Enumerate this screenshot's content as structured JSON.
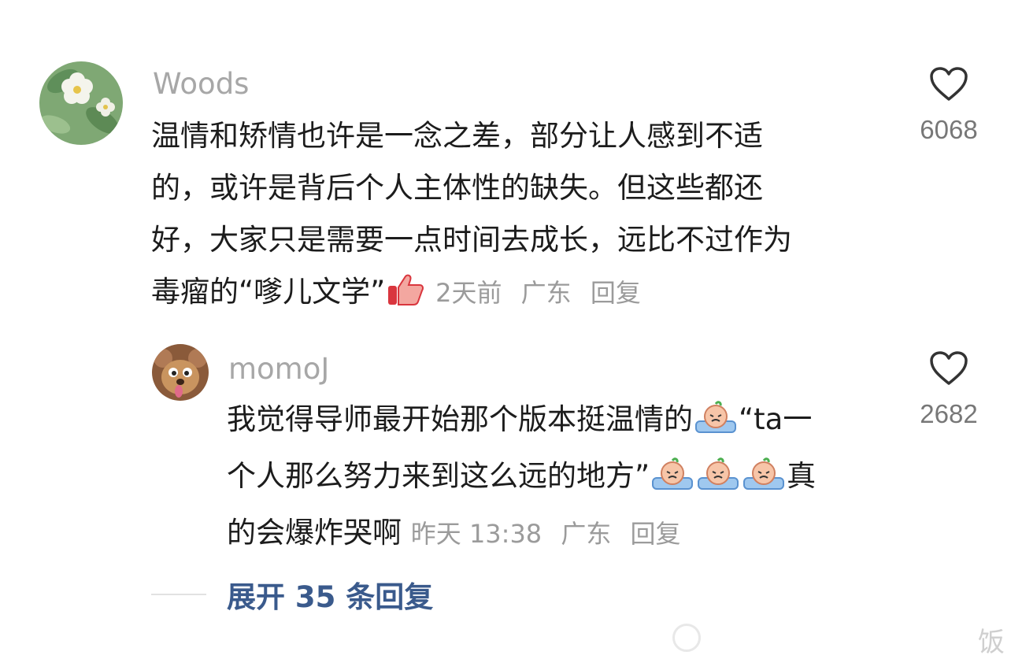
{
  "comment1": {
    "username": "Woods",
    "lines": [
      "温情和矫情也许是一念之差，部分让人感到不适",
      "的，或许是背后个人主体性的缺失。但这些都还",
      "好，大家只是需要一点时间去成长，远比不过作为",
      "毒瘤的“嗲儿文学”"
    ],
    "emoji_icon": "thumbs-up-emoji",
    "time": "2天前",
    "location": "广东",
    "reply_label": "回复",
    "like_count": "6068"
  },
  "comment2": {
    "username": "momoJ",
    "line1": "我觉得导师最开始那个版本挺温情的",
    "line1_tail": "“ta一",
    "line2": "个人那么努力来到这么远的地方”",
    "line2_tail": "真",
    "line3": "的会爆炸哭啊",
    "emoji_icon": "crying-peach-emoji",
    "time": "昨天 13:38",
    "location": "广东",
    "reply_label": "回复",
    "like_count": "2682"
  },
  "expand_label": "展开 35 条回复",
  "watermark_text": "饭",
  "colors": {
    "link": "#3a5a8c",
    "meta": "#9b9b9b",
    "username": "#a7a7a7"
  }
}
